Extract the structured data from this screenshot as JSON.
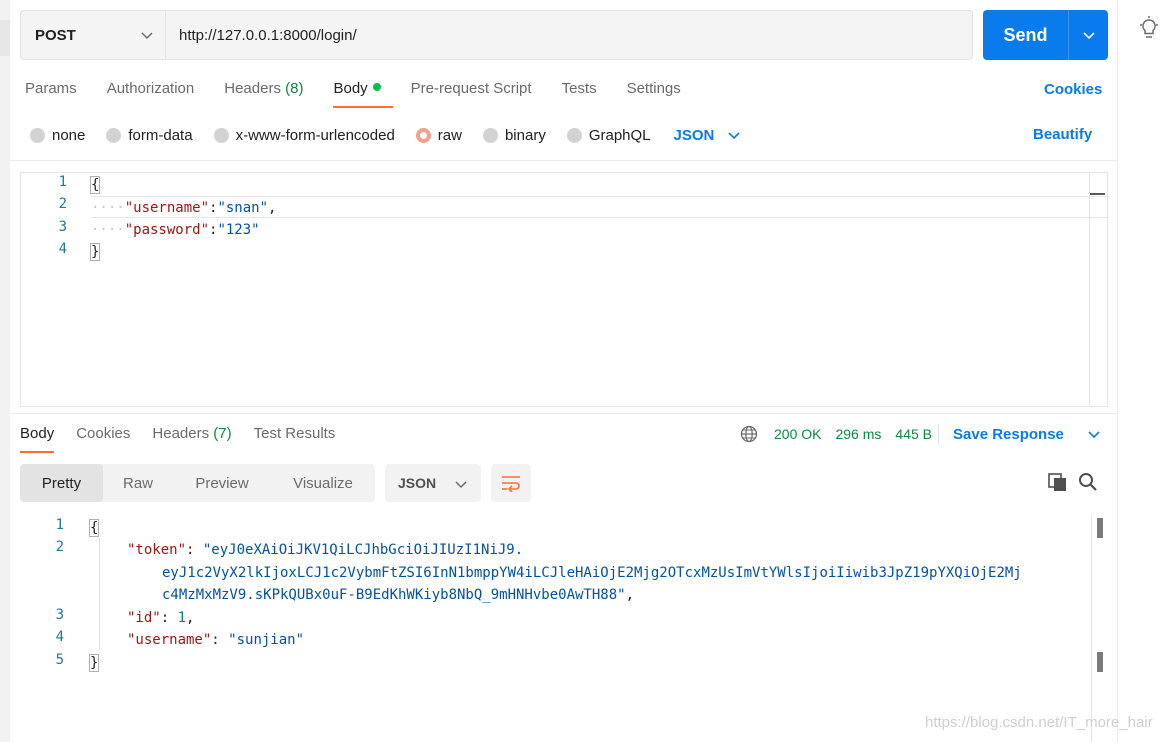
{
  "request": {
    "method": "POST",
    "url": "http://127.0.0.1:8000/login/",
    "send_label": "Send"
  },
  "request_tabs": [
    {
      "label": "Params"
    },
    {
      "label": "Authorization"
    },
    {
      "label": "Headers",
      "count": "(8)"
    },
    {
      "label": "Body"
    },
    {
      "label": "Pre-request Script"
    },
    {
      "label": "Tests"
    },
    {
      "label": "Settings"
    }
  ],
  "cookies_link": "Cookies",
  "body_types": [
    "none",
    "form-data",
    "x-www-form-urlencoded",
    "raw",
    "binary",
    "GraphQL"
  ],
  "body_format": "JSON",
  "beautify_label": "Beautify",
  "request_body": {
    "line_numbers": [
      "1",
      "2",
      "3",
      "4"
    ],
    "open_brace": "{",
    "close_brace": "}",
    "username_key": "\"username\"",
    "username_value": "\"snan\"",
    "password_key": "\"password\"",
    "password_value": "\"123\""
  },
  "response_tabs": [
    {
      "label": "Body"
    },
    {
      "label": "Cookies"
    },
    {
      "label": "Headers",
      "count": "(7)"
    },
    {
      "label": "Test Results"
    }
  ],
  "response_status": {
    "code": "200 OK",
    "time": "296 ms",
    "size": "445 B"
  },
  "save_response_label": "Save Response",
  "view_modes": [
    "Pretty",
    "Raw",
    "Preview",
    "Visualize"
  ],
  "response_format": "JSON",
  "response_body": {
    "line_numbers": [
      "1",
      "2",
      "3",
      "4",
      "5"
    ],
    "open_brace": "{",
    "close_brace": "}",
    "token_key": "\"token\"",
    "token_value_1": "\"eyJ0eXAiOiJKV1QiLCJhbGciOiJIUzI1NiJ9.",
    "token_value_2": "eyJ1c2VyX2lkIjoxLCJ1c2VybmFtZSI6InN1bmppYW4iLCJleHAiOjE2Mjg2OTcxMzUsImVtYWlsIjoiIiwib3JpZ19pYXQiOjE2Mj",
    "token_value_3": "c4MzMxMzV9.sKPkQUBx0uF-B9EdKhWKiyb8NbQ_9mHNHvbe0AwTH88\"",
    "id_key": "\"id\"",
    "id_value": "1",
    "username_key": "\"username\"",
    "username_value": "\"sunjian\""
  },
  "watermark": "https://blog.csdn.net/IT_more_hair",
  "colors": {
    "accent": "#097bed",
    "active_tab": "#ff6c37",
    "status_ok": "#0b8a3e"
  }
}
